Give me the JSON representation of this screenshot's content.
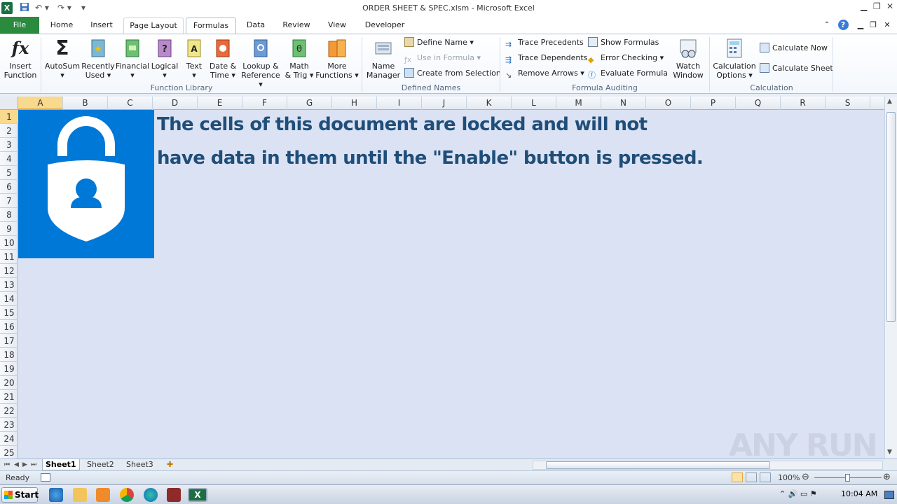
{
  "window": {
    "app_icon": "X",
    "title": "ORDER SHEET & SPEC.xlsm  -  Microsoft Excel",
    "undo_icon": "undo-icon",
    "redo_icon": "redo-icon"
  },
  "tabs": [
    "File",
    "Home",
    "Insert",
    "Page Layout",
    "Formulas",
    "Data",
    "Review",
    "View",
    "Developer"
  ],
  "active_tab": "Formulas",
  "ribbon": {
    "function_library": {
      "label": "Function Library",
      "buttons": [
        {
          "line1": "Insert",
          "line2": "Function",
          "icon": "fx-icon"
        },
        {
          "line1": "AutoSum",
          "line2": "▾",
          "icon": "sigma-icon"
        },
        {
          "line1": "Recently",
          "line2": "Used ▾",
          "icon": "star-book-icon"
        },
        {
          "line1": "Financial",
          "line2": "▾",
          "icon": "money-book-icon"
        },
        {
          "line1": "Logical",
          "line2": "▾",
          "icon": "question-book-icon"
        },
        {
          "line1": "Text",
          "line2": "▾",
          "icon": "a-book-icon"
        },
        {
          "line1": "Date &",
          "line2": "Time ▾",
          "icon": "clock-book-icon"
        },
        {
          "line1": "Lookup &",
          "line2": "Reference ▾",
          "icon": "magnifier-book-icon"
        },
        {
          "line1": "Math",
          "line2": "& Trig ▾",
          "icon": "theta-book-icon"
        },
        {
          "line1": "More",
          "line2": "Functions ▾",
          "icon": "books-icon"
        }
      ]
    },
    "defined_names": {
      "label": "Defined Names",
      "name_manager": {
        "line1": "Name",
        "line2": "Manager"
      },
      "define_name": "Define Name ▾",
      "use_in_formula": "Use in Formula ▾",
      "create_from_selection": "Create from Selection"
    },
    "formula_auditing": {
      "label": "Formula Auditing",
      "trace_precedents": "Trace Precedents",
      "trace_dependents": "Trace Dependents",
      "remove_arrows": "Remove Arrows ▾",
      "show_formulas": "Show Formulas",
      "error_checking": "Error Checking ▾",
      "evaluate_formula": "Evaluate Formula",
      "watch_window": {
        "line1": "Watch",
        "line2": "Window"
      }
    },
    "calculation": {
      "label": "Calculation",
      "calc_options": {
        "line1": "Calculation",
        "line2": "Options ▾"
      },
      "calc_now": "Calculate Now",
      "calc_sheet": "Calculate Sheet"
    }
  },
  "columns": [
    "A",
    "B",
    "C",
    "D",
    "E",
    "F",
    "G",
    "H",
    "I",
    "J",
    "K",
    "L",
    "M",
    "N",
    "O",
    "P",
    "Q",
    "R",
    "S"
  ],
  "rows": [
    "1",
    "2",
    "3",
    "4",
    "5",
    "6",
    "7",
    "8",
    "9",
    "10",
    "11",
    "12",
    "13",
    "14",
    "15",
    "16",
    "17",
    "18",
    "19",
    "20",
    "21",
    "22",
    "23",
    "24",
    "25"
  ],
  "message": {
    "line1": "The cells of this document are locked and will not",
    "line2": "have data in them until the \"Enable\" button is pressed."
  },
  "sheets": [
    "Sheet1",
    "Sheet2",
    "Sheet3"
  ],
  "active_sheet": "Sheet1",
  "status": {
    "text": "Ready",
    "zoom": "100%"
  },
  "taskbar": {
    "start": "Start",
    "clock": "10:04 AM"
  },
  "watermark": "ANY RUN",
  "colors": {
    "lock_bg": "#0078d7",
    "message": "#1f4e79",
    "cells_bg": "#dbe2f3",
    "file_tab": "#2a8a3e"
  }
}
